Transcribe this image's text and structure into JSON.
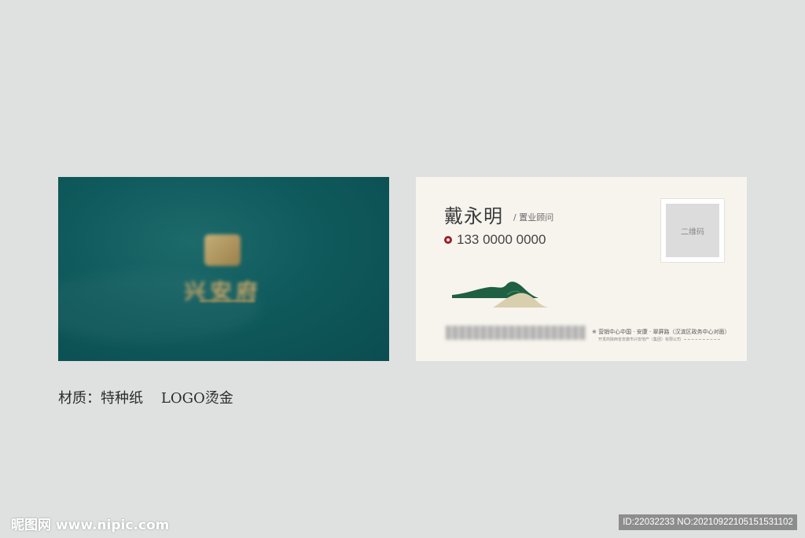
{
  "front": {
    "logo_text": "兴安府",
    "logo_emblem": "logo-emblem-icon"
  },
  "back": {
    "name": "戴永明",
    "title": "/ 置业顾问",
    "phone": "133 0000 0000",
    "phone_icon": "phone-icon",
    "qr_label": "二维码",
    "address_line1": "※ 营销中心中国 · 安康 · 翠屏路（汉滨区政务中心对面）",
    "address_line2": "开发商陕西省安康市兴安地产（集团）有限公司"
  },
  "caption": "材质：特种纸    LOGO烫金",
  "watermark": {
    "site": "昵图网 www.nipic.com",
    "id": "ID:22032233 NO:20210922105151531102"
  },
  "colors": {
    "front_bg": "#0f5a5c",
    "gold": "#c9a666",
    "back_bg": "#f7f4ee",
    "accent_red": "#9a1f28",
    "mountain_green": "#1f5f42",
    "sand": "#d9cfae",
    "page_bg": "#dfe1e0"
  }
}
